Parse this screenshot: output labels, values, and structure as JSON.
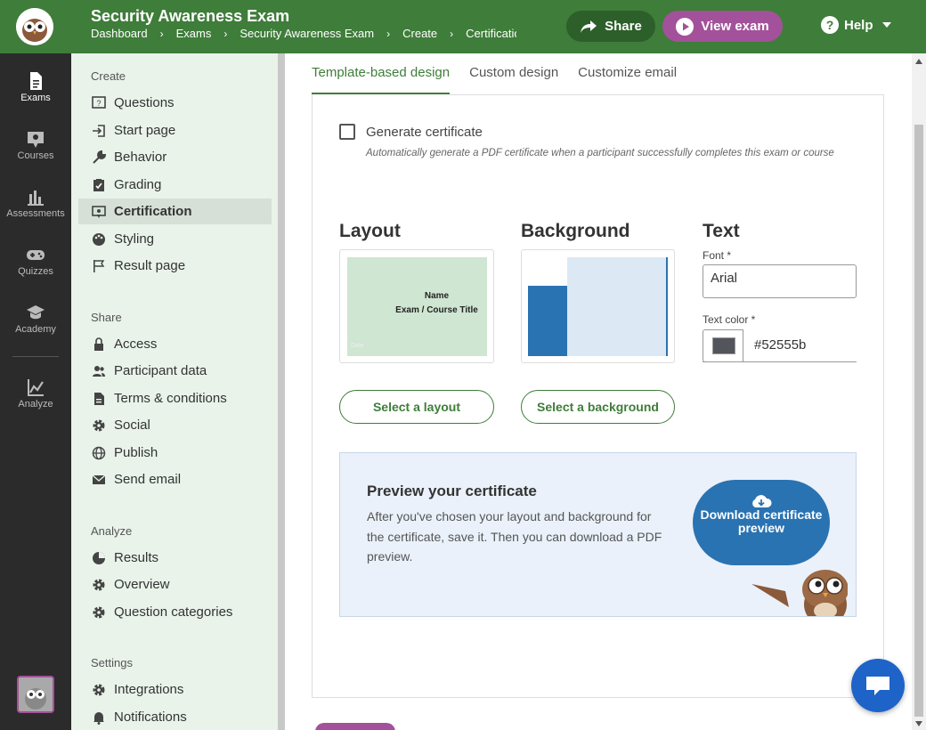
{
  "header": {
    "title": "Security Awareness Exam",
    "breadcrumb": [
      "Dashboard",
      "Exams",
      "Security Awareness Exam",
      "Create",
      "Certification"
    ],
    "breadcrumb_sep": "›",
    "share_label": "Share",
    "view_label": "View exam",
    "help_label": "Help",
    "help_glyph": "?"
  },
  "rail": {
    "items": [
      {
        "label": "Exams",
        "icon": "document-icon"
      },
      {
        "label": "Courses",
        "icon": "courses-icon"
      },
      {
        "label": "Assessments",
        "icon": "bar-chart-icon"
      },
      {
        "label": "Quizzes",
        "icon": "gamepad-icon"
      },
      {
        "label": "Academy",
        "icon": "graduation-cap-icon"
      },
      {
        "label": "Analyze",
        "icon": "line-chart-icon"
      }
    ]
  },
  "subnav": {
    "create_heading": "Create",
    "create_items": [
      "Questions",
      "Start page",
      "Behavior",
      "Grading",
      "Certification",
      "Styling",
      "Result page"
    ],
    "share_heading": "Share",
    "share_items": [
      "Access",
      "Participant data",
      "Terms & conditions",
      "Social",
      "Publish",
      "Send email"
    ],
    "analyze_heading": "Analyze",
    "analyze_items": [
      "Results",
      "Overview",
      "Question categories"
    ],
    "settings_heading": "Settings",
    "settings_items": [
      "Integrations",
      "Notifications"
    ]
  },
  "tabs": [
    "Template-based design",
    "Custom design",
    "Customize email"
  ],
  "certificate": {
    "generate_label": "Generate certificate",
    "generate_help": "Automatically generate a PDF certificate when a participant successfully completes this exam or course",
    "layout_title": "Layout",
    "layout_name": "Name",
    "layout_course": "Exam / Course Title",
    "layout_date": "Date",
    "background_title": "Background",
    "text_title": "Text",
    "font_label": "Font *",
    "font_value": "Arial",
    "color_label": "Text color *",
    "color_value": "#52555b",
    "select_layout": "Select a layout",
    "select_background": "Select a background"
  },
  "preview": {
    "title": "Preview your certificate",
    "text": "After you've chosen your layout and background for the certificate, save it. Then you can download a PDF preview.",
    "download_label": "Download certificate preview"
  },
  "colors": {
    "brand_green": "#3f7d3a",
    "brand_purple": "#a3519a",
    "accent_blue": "#2a73b2"
  }
}
